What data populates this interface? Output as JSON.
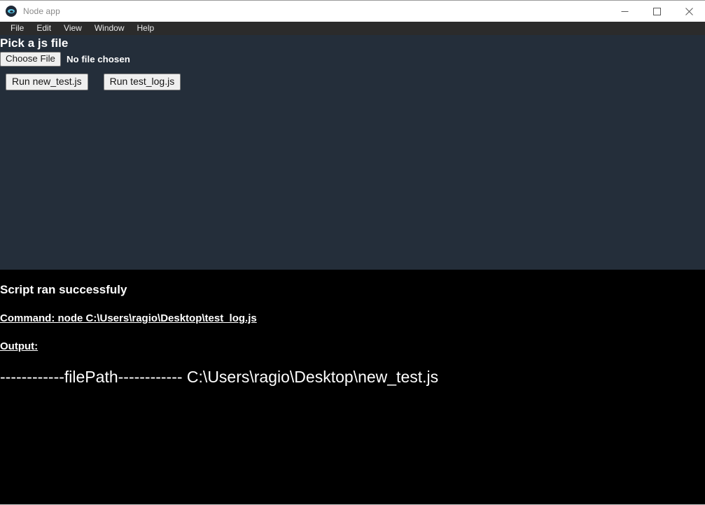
{
  "window": {
    "title": "Node app",
    "app_icon": "node-logo-icon",
    "controls": {
      "minimize": "minimize-icon",
      "maximize": "maximize-icon",
      "close": "close-icon"
    }
  },
  "menubar": {
    "items": [
      {
        "label": "File"
      },
      {
        "label": "Edit"
      },
      {
        "label": "View"
      },
      {
        "label": "Window"
      },
      {
        "label": "Help"
      }
    ]
  },
  "app": {
    "heading": "Pick a js file",
    "file_input": {
      "button_label": "Choose File",
      "status_text": "No file chosen"
    },
    "run_buttons": [
      {
        "label": "Run new_test.js"
      },
      {
        "label": "Run test_log.js"
      }
    ]
  },
  "console": {
    "status": "Script ran successfuly",
    "command": "Command: node C:\\Users\\ragio\\Desktop\\test_log.js",
    "output_label": "Output:",
    "output_body": "------------filePath------------ C:\\Users\\ragio\\Desktop\\new_test.js"
  },
  "colors": {
    "titlebar_bg": "#ffffff",
    "menubar_bg": "#2b2b2b",
    "panel_bg": "#242e3a",
    "console_bg": "#000000",
    "console_text": "#ffffff",
    "button_bg": "#efefef"
  }
}
